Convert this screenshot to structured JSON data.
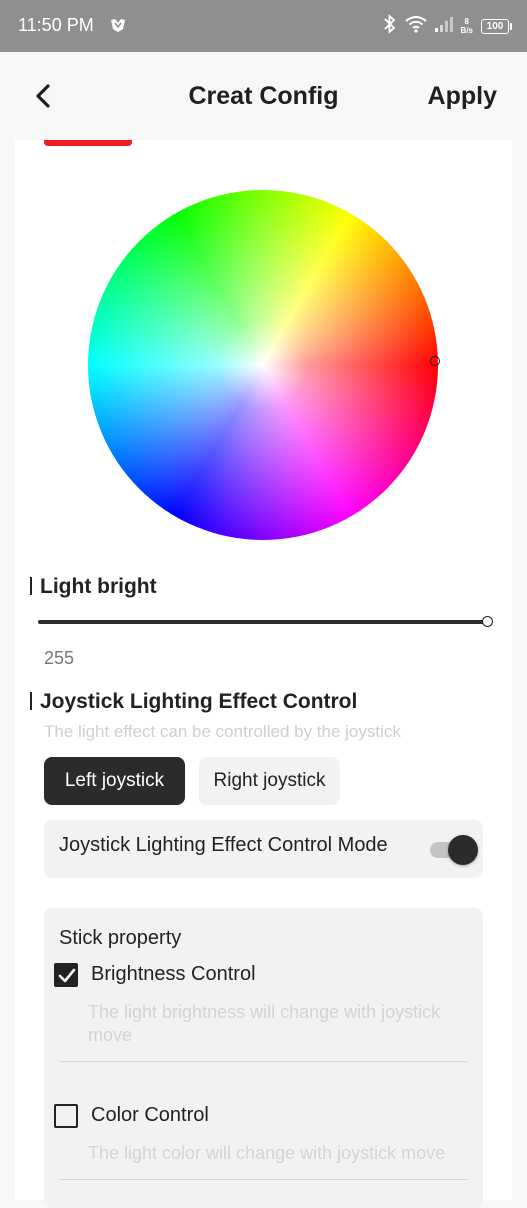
{
  "status_bar": {
    "time": "11:50 PM",
    "net_speed_value": "8",
    "net_speed_unit": "B/s",
    "battery": "100",
    "icons": [
      "app-icon",
      "bluetooth-icon",
      "wifi-icon",
      "signal-icon"
    ]
  },
  "header": {
    "title": "Creat Config",
    "apply_label": "Apply",
    "back_icon": "chevron-left-icon"
  },
  "selected_color": "#ee1d23",
  "light_bright": {
    "title": "Light bright",
    "value": "255",
    "max": 255,
    "level": 1.0
  },
  "joystick": {
    "title": "Joystick Lighting Effect Control",
    "subtitle": "The light effect can be controlled by the joystick",
    "tabs": [
      {
        "label": "Left joystick",
        "active": true
      },
      {
        "label": "Right joystick",
        "active": false
      }
    ],
    "mode_label": "Joystick Lighting Effect Control Mode",
    "mode_on": true
  },
  "stick_property": {
    "title": "Stick property",
    "options": [
      {
        "label": "Brightness Control",
        "description": "The light brightness will change with joystick move",
        "checked": true
      },
      {
        "label": "Color Control",
        "description": "The light color will change with joystick move",
        "checked": false
      }
    ]
  }
}
